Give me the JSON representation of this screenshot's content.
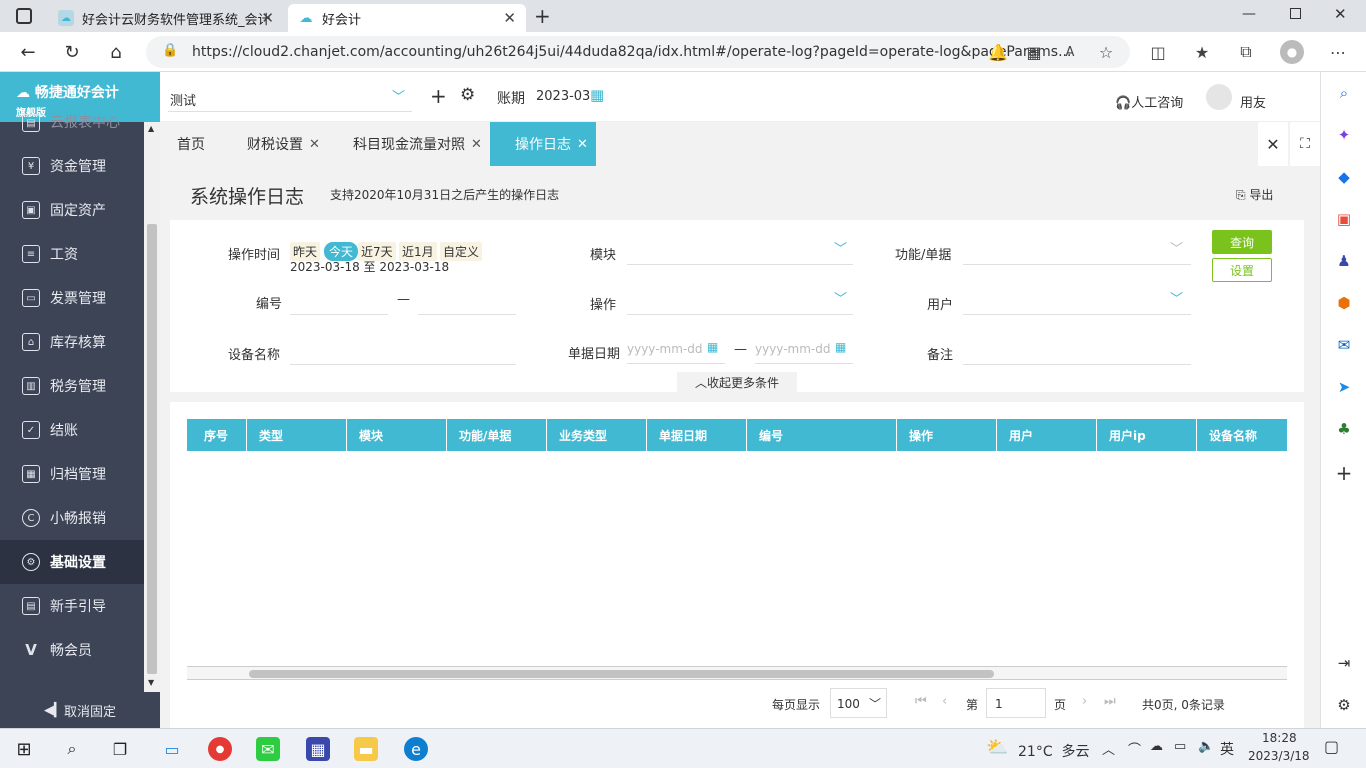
{
  "browser": {
    "tabs": [
      {
        "title": "好会计云财务软件管理系统_会计"
      },
      {
        "title": "好会计"
      }
    ],
    "url": "https://cloud2.chanjet.com/accounting/uh26t264j5ui/44duda82qa/idx.html#/operate-log?pageId=operate-log&pageParams..."
  },
  "sidebar": {
    "brand": "畅捷通好会计",
    "edition": "旗舰版",
    "items": [
      {
        "label": "云报表中心"
      },
      {
        "label": "资金管理"
      },
      {
        "label": "固定资产"
      },
      {
        "label": "工资"
      },
      {
        "label": "发票管理"
      },
      {
        "label": "库存核算"
      },
      {
        "label": "税务管理"
      },
      {
        "label": "结账"
      },
      {
        "label": "归档管理"
      },
      {
        "label": "小畅报销"
      },
      {
        "label": "基础设置"
      },
      {
        "label": "新手引导"
      },
      {
        "label": "畅会员"
      }
    ],
    "unpin": "取消固定"
  },
  "topbar": {
    "company": "测试",
    "period_label": "账期",
    "period_value": "2023-03",
    "consult": "人工咨询",
    "user": "用友"
  },
  "app_tabs": [
    {
      "label": "首页"
    },
    {
      "label": "财税设置"
    },
    {
      "label": "科目现金流量对照"
    },
    {
      "label": "操作日志"
    }
  ],
  "page": {
    "title": "系统操作日志",
    "subtitle": "支持2020年10月31日之后产生的操作日志",
    "export": "导出"
  },
  "filters": {
    "op_time_label": "操作时间",
    "quick": [
      "昨天",
      "今天",
      "近7天",
      "近1月",
      "自定义"
    ],
    "date_range": "2023-03-18 至 2023-03-18",
    "module_label": "模块",
    "func_label": "功能/单据",
    "code_label": "编号",
    "code_sep": "—",
    "op_label": "操作",
    "user_label": "用户",
    "device_label": "设备名称",
    "docdate_label": "单据日期",
    "docdate_placeholder": "yyyy-mm-dd",
    "docdate_sep": "—",
    "remark_label": "备注",
    "collapse": "收起更多条件",
    "query_btn": "查询",
    "settings_btn": "设置"
  },
  "table": {
    "columns": [
      "序号",
      "类型",
      "模块",
      "功能/单据",
      "业务类型",
      "单据日期",
      "编号",
      "操作",
      "用户",
      "用户ip",
      "设备名称"
    ]
  },
  "pager": {
    "per_page_label": "每页显示",
    "per_page_value": "100",
    "page_prefix": "第",
    "page_value": "1",
    "page_suffix": "页",
    "summary": "共0页, 0条记录"
  },
  "taskbar": {
    "weather": "21°C  多云",
    "ime": "英",
    "time": "18:28",
    "date": "2023/3/18"
  },
  "colors": {
    "accent": "#41b9d2",
    "sidebar": "#3d4456",
    "query_green": "#7ac31c"
  }
}
